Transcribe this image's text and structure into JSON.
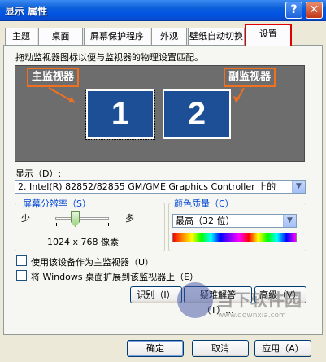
{
  "window": {
    "title": "显示 属性",
    "help_glyph": "?",
    "close_glyph": "✕"
  },
  "tabs": [
    {
      "label": "主题"
    },
    {
      "label": "桌面"
    },
    {
      "label": "屏幕保护程序"
    },
    {
      "label": "外观"
    },
    {
      "label": "壁纸自动切换"
    },
    {
      "label": "设置",
      "active": true
    }
  ],
  "instruction": "拖动监视器图标以便与监视器的物理设置匹配。",
  "monitors": {
    "primary_callout": "主监视器",
    "secondary_callout": "副监视器",
    "monitor1": "1",
    "monitor2": "2"
  },
  "display": {
    "label": "显示（D）:",
    "value": "2. Intel(R) 82852/82855 GM/GME Graphics Controller 上的"
  },
  "resolution": {
    "title": "屏幕分辨率（S）",
    "less": "少",
    "more": "多",
    "value_text": "1024 x 768 像素",
    "slider_level": 0.35
  },
  "color_quality": {
    "title": "颜色质量（C）",
    "value": "最高（32 位）"
  },
  "checkboxes": [
    {
      "label": "使用该设备作为主监视器（U）",
      "checked": false
    },
    {
      "label": "将 Windows 桌面扩展到该监视器上（E）",
      "checked": false
    }
  ],
  "panel_buttons": {
    "identify": "识别（I）",
    "troubleshoot": "疑难解答（T）...",
    "advanced": "高级（V）"
  },
  "dialog_buttons": {
    "ok": "确定",
    "cancel": "取消",
    "apply": "应用（A）"
  },
  "watermark": {
    "text": "当下软件园",
    "url": "www.downxia.com"
  },
  "colors": {
    "title_bar": "#0054e3",
    "monitor_fill": "#1c4f96",
    "callout_border": "#f07020",
    "active_tab_border": "#e00000",
    "group_title": "#0046d5"
  }
}
